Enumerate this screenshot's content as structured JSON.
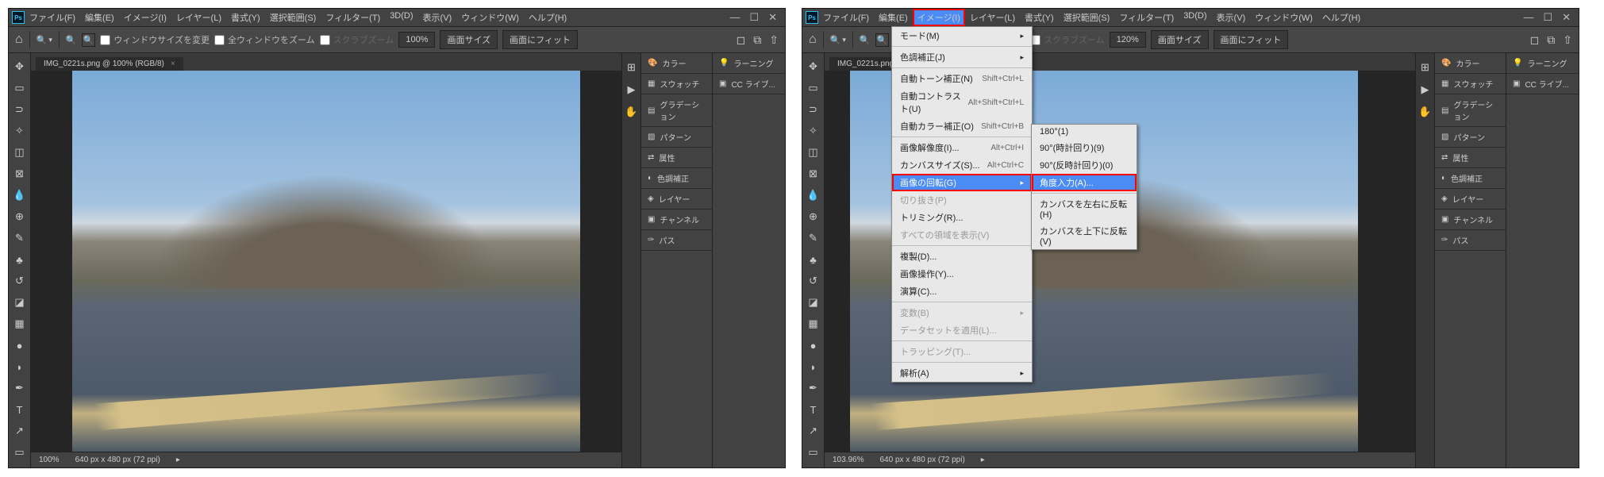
{
  "menubar": {
    "items": [
      "ファイル(F)",
      "編集(E)",
      "イメージ(I)",
      "レイヤー(L)",
      "書式(Y)",
      "選択範囲(S)",
      "フィルター(T)",
      "3D(D)",
      "表示(V)",
      "ウィンドウ(W)",
      "ヘルプ(H)"
    ]
  },
  "toolbar": {
    "resize": "ウィンドウサイズを変更",
    "allwin": "全ウィンドウをズーム",
    "scrub": "スクラブズーム",
    "zoom100": "100%",
    "fit_screen": "画面サイズ",
    "fit_win": "画面にフィット"
  },
  "doc_tab": {
    "label_left": "IMG_0221s.png @ 100% (RGB/8)",
    "label_right": "IMG_0221s.png"
  },
  "panels_left": [
    "カラー",
    "スウォッチ",
    "グラデーション",
    "パターン",
    "属性",
    "色調補正",
    "レイヤー",
    "チャンネル",
    "パス"
  ],
  "panels_right": [
    "ラーニング",
    "CC ライブ..."
  ],
  "status_left": {
    "zoom": "100%",
    "dims": "640 px x 480 px (72 ppi)"
  },
  "status_right": {
    "zoom": "103.96%",
    "dims": "640 px x 480 px (72 ppi)"
  },
  "image_menu": {
    "mode": "モード(M)",
    "adjustments": "色調補正(J)",
    "auto_tone": {
      "label": "自動トーン補正(N)",
      "sc": "Shift+Ctrl+L"
    },
    "auto_contrast": {
      "label": "自動コントラスト(U)",
      "sc": "Alt+Shift+Ctrl+L"
    },
    "auto_color": {
      "label": "自動カラー補正(O)",
      "sc": "Shift+Ctrl+B"
    },
    "img_size": {
      "label": "画像解像度(I)...",
      "sc": "Alt+Ctrl+I"
    },
    "canvas_size": {
      "label": "カンバスサイズ(S)...",
      "sc": "Alt+Ctrl+C"
    },
    "rotate": "画像の回転(G)",
    "crop": "切り抜き(P)",
    "trim": "トリミング(R)...",
    "reveal": "すべての領域を表示(V)",
    "duplicate": "複製(D)...",
    "apply": "画像操作(Y)...",
    "calc": "演算(C)...",
    "vars": "変数(B)",
    "dataset": "データセットを適用(L)...",
    "trap": "トラッピング(T)...",
    "analysis": "解析(A)"
  },
  "rotate_submenu": {
    "r180": "180°(1)",
    "r90cw": "90°(時計回り)(9)",
    "r90ccw": "90°(反時計回り)(0)",
    "arbitrary": "角度入力(A)...",
    "flip_h": "カンバスを左右に反転(H)",
    "flip_v": "カンバスを上下に反転(V)"
  },
  "right_toolbar": {
    "zoom": "120%"
  }
}
